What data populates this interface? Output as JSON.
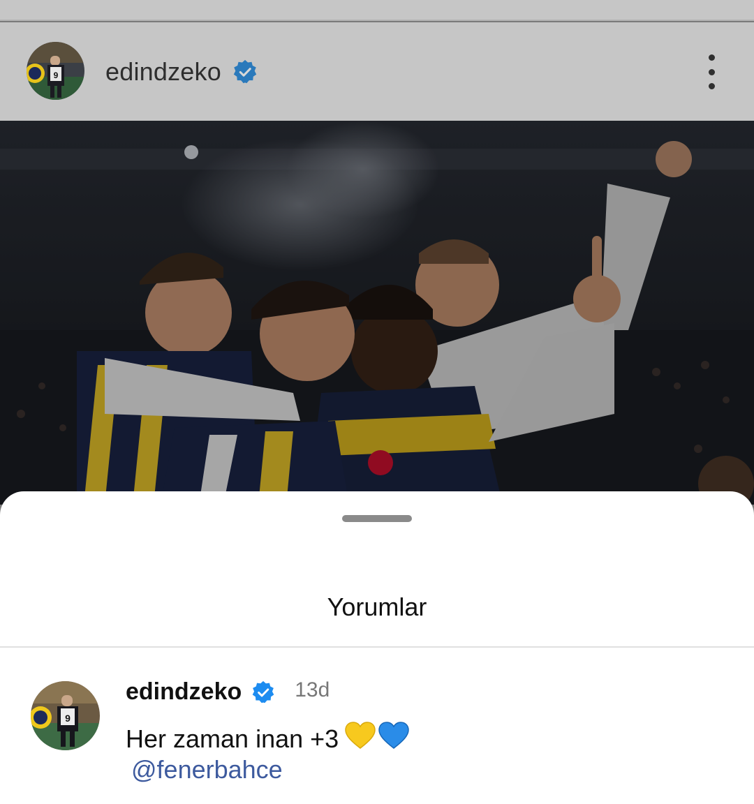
{
  "post": {
    "username": "edindzeko",
    "verified_icon": "verified-badge-icon",
    "more_icon": "more-vertical-icon"
  },
  "sheet": {
    "title": "Yorumlar"
  },
  "comment": {
    "username": "edindzeko",
    "time": "13d",
    "text": "Her zaman inan +3",
    "emoji_1": "💛",
    "emoji_2": "💙",
    "mention": "@fenerbahce"
  },
  "colors": {
    "verified": "#1d8cf0",
    "mention": "#3d5a9e",
    "dim_overlay": "#c6c6c6",
    "sheet": "#ffffff"
  }
}
